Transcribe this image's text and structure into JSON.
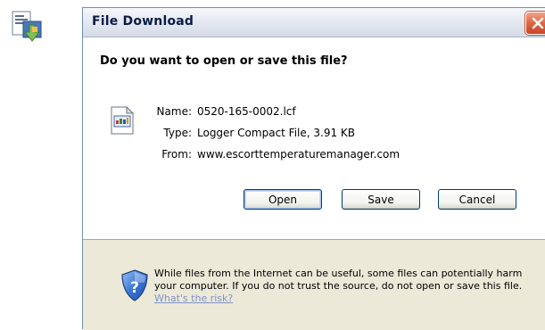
{
  "dialog": {
    "title": "File Download",
    "question": "Do you want to open or save this file?"
  },
  "file_info": [
    {
      "label": "Name:",
      "value": "0520-165-0002.lcf"
    },
    {
      "label": "Type:",
      "value": "Logger Compact File, 3.91 KB"
    },
    {
      "label": "From:",
      "value": "www.escorttemperaturemanager.com"
    }
  ],
  "buttons": {
    "open": "Open",
    "save": "Save",
    "cancel": "Cancel"
  },
  "warning": {
    "text": "While files from the Internet can be useful, some files can potentially harm your computer. If you do not trust the source, do not open or save this file.",
    "link": "What's the risk?"
  },
  "icons": {
    "desktop": "file-download-program-icon",
    "close": "close-icon",
    "file": "lcf-file-icon",
    "warning": "security-shield-icon"
  },
  "colors": {
    "title_text": "#0b1a44",
    "close_button": "#e06541",
    "dialog_face": "#ece9d8",
    "link": "#7e92c7"
  }
}
